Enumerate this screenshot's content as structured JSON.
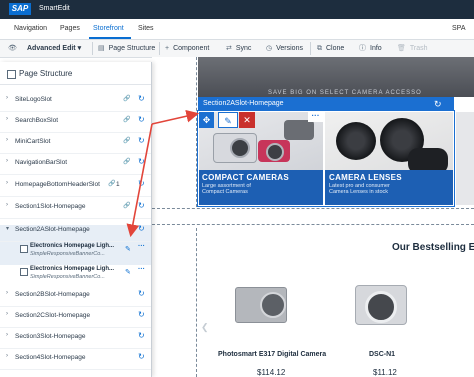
{
  "app": {
    "logo": "SAP",
    "title": "SmartEdit"
  },
  "nav_tabs": [
    {
      "label": "Navigation"
    },
    {
      "label": "Pages"
    },
    {
      "label": "Storefront"
    },
    {
      "label": "Sites"
    }
  ],
  "active_tab": "Storefront",
  "site_label": "SPA Elec",
  "toolbar": {
    "mode": "Advanced Edit",
    "page_structure": "Page Structure",
    "component": "Component",
    "sync": "Sync",
    "versions": "Versions",
    "clone": "Clone",
    "info": "Info",
    "trash": "Trash"
  },
  "panel": {
    "title": "Page Structure",
    "slots": [
      {
        "label": "SiteLogoSlot"
      },
      {
        "label": "SearchBoxSlot"
      },
      {
        "label": "MiniCartSlot"
      },
      {
        "label": "NavigationBarSlot"
      },
      {
        "label": "HomepageBottomHeaderSlot",
        "count": "1"
      },
      {
        "label": "Section1Slot-Homepage"
      },
      {
        "label": "Section2ASlot-Homepage"
      },
      {
        "label": "Section2BSlot-Homepage"
      },
      {
        "label": "Section2CSlot-Homepage"
      },
      {
        "label": "Section3Slot-Homepage"
      },
      {
        "label": "Section4Slot-Homepage"
      }
    ],
    "children": [
      {
        "title": "Electronics Homepage Ligh...",
        "subtitle": "SimpleResponsiveBannerCo..."
      },
      {
        "title": "Electronics Homepage Ligh...",
        "subtitle": "SimpleResponsiveBannerCo..."
      }
    ]
  },
  "page": {
    "banner_text": "SAVE BIG ON SELECT CAMERA ACCESSO",
    "section_title": "Section2ASlot-Homepage",
    "cards": [
      {
        "heading": "COMPACT CAMERAS",
        "sub1": "Large assortment of",
        "sub2": "Compact Cameras"
      },
      {
        "heading": "CAMERA LENSES",
        "sub1": "Latest pro and consumer",
        "sub2": "Camera Lenses in stock"
      }
    ],
    "bestselling": "Our Bestselling E",
    "products": [
      {
        "name": "Photosmart E317 Digital Camera",
        "price": "$114.12"
      },
      {
        "name": "DSC-N1",
        "price": "$11.12"
      }
    ]
  },
  "colors": {
    "accent": "#0a6ed1",
    "highlight": "#1b6fd1",
    "delete": "#c9302c",
    "annotation": "#e2453a"
  },
  "icons": [
    "eye-icon",
    "page-structure-icon",
    "plus-icon",
    "sync-icon",
    "versions-icon",
    "clone-icon",
    "info-icon",
    "trash-icon",
    "link-icon",
    "move-icon",
    "pencil-icon",
    "close-icon",
    "more-icon"
  ]
}
